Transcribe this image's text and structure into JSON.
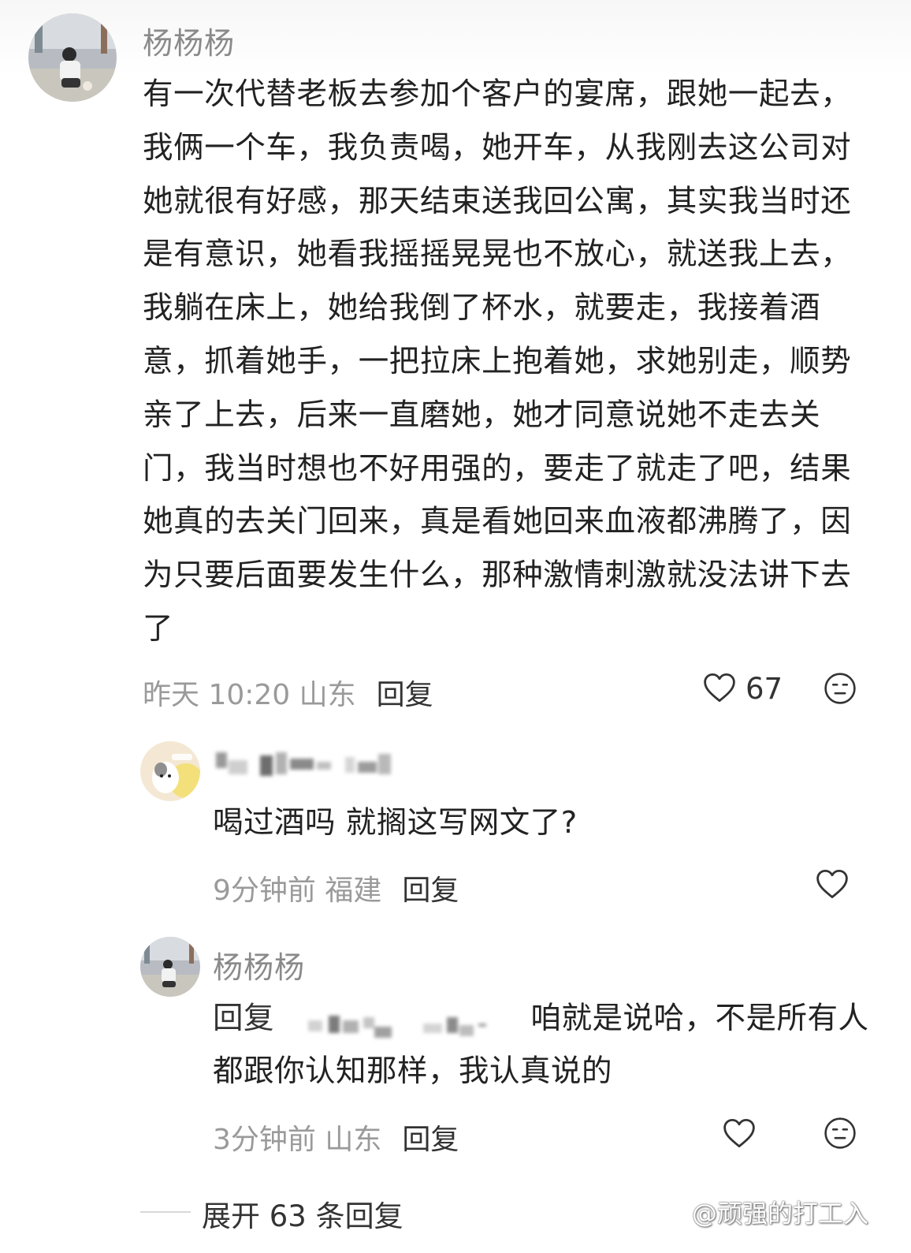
{
  "main_comment": {
    "username": "杨杨杨",
    "text": "有一次代替老板去参加个客户的宴席，跟她一起去，我俩一个车，我负责喝，她开车，从我刚去这公司对她就很有好感，那天结束送我回公寓，其实我当时还是有意识，她看我摇摇晃晃也不放心，就送我上去，我躺在床上，她给我倒了杯水，就要走，我接着酒意，抓着她手，一把拉床上抱着她，求她别走，顺势亲了上去，后来一直磨她，她才同意说她不走去关门，我当时想也不好用强的，要走了就走了吧，结果她真的去关门回来，真是看她回来血液都沸腾了，因为只要后面要发生什么，那种激情刺激就没法讲下去了",
    "meta": "昨天 10:20 山东",
    "reply_label": "回复",
    "like_count": "67",
    "like_icon": "heart-outline-icon",
    "emoji_icon": "neutral-face-icon"
  },
  "replies": [
    {
      "username": "",
      "text": "喝过酒吗 就搁这写网文了?",
      "meta": "9分钟前 福建",
      "reply_label": "回复",
      "like_icon": "heart-outline-icon"
    },
    {
      "username": "杨杨杨",
      "reply_prefix": "回复",
      "text": "咱就是说哈，不是所有人都跟你认知那样，我认真说的",
      "meta": "3分钟前 山东",
      "reply_label": "回复",
      "like_icon": "heart-outline-icon",
      "emoji_icon": "neutral-face-icon"
    }
  ],
  "footer": {
    "expand_label": "展开 63 条回复",
    "watermark": "@顽强的打工入"
  },
  "colors": {
    "primary_text": "#222222",
    "secondary_text": "#9a9a9a",
    "username": "#8a8a8a",
    "icon": "#333333"
  }
}
